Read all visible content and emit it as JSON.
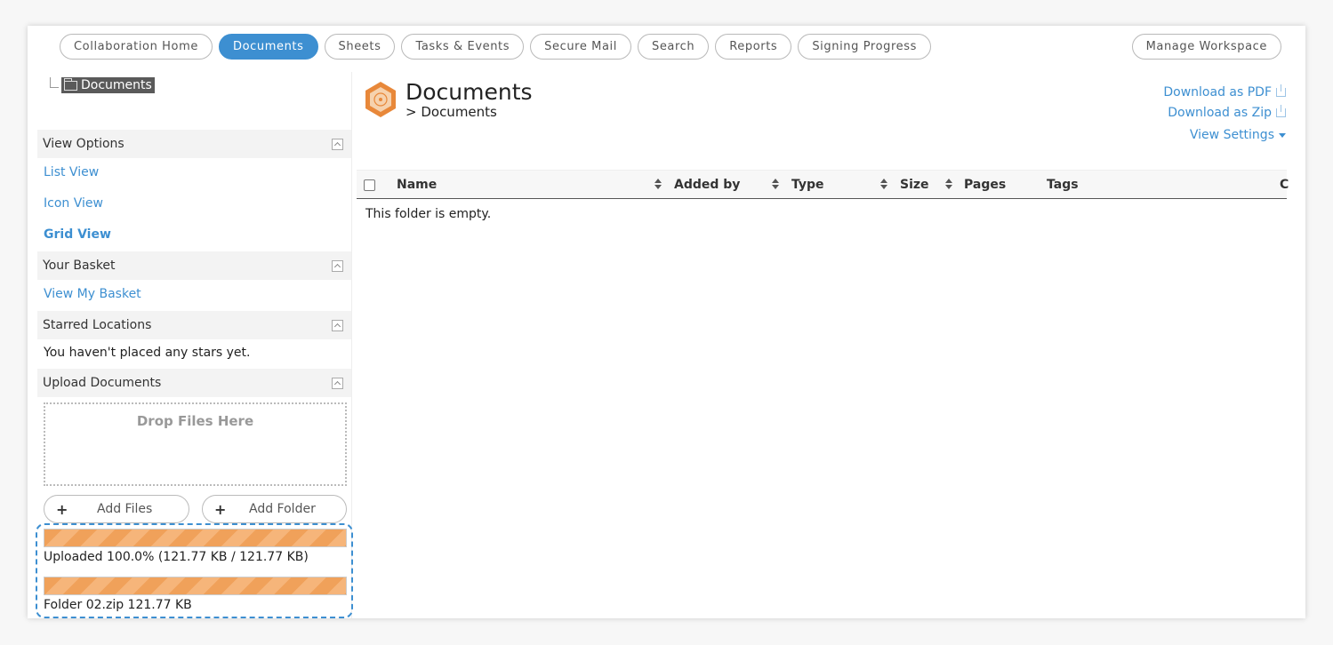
{
  "nav": {
    "tabs": [
      {
        "label": "Collaboration Home"
      },
      {
        "label": "Documents",
        "active": true
      },
      {
        "label": "Sheets"
      },
      {
        "label": "Tasks & Events"
      },
      {
        "label": "Secure Mail"
      },
      {
        "label": "Search"
      },
      {
        "label": "Reports"
      },
      {
        "label": "Signing Progress"
      }
    ],
    "manage": "Manage Workspace"
  },
  "tree": {
    "root": "Documents"
  },
  "sidebar": {
    "view_options": {
      "title": "View Options",
      "items": [
        "List View",
        "Icon View",
        "Grid View"
      ],
      "selected": "Grid View"
    },
    "basket": {
      "title": "Your Basket",
      "link": "View My Basket"
    },
    "starred": {
      "title": "Starred Locations",
      "empty": "You haven't placed any stars yet."
    },
    "upload": {
      "title": "Upload Documents",
      "drop": "Drop Files Here",
      "add_files": "Add Files",
      "add_folder": "Add Folder",
      "progress": [
        {
          "percent": 100,
          "text": "Uploaded 100.0% (121.77 KB / 121.77 KB)"
        },
        {
          "percent": 100,
          "text": "Folder 02.zip 121.77 KB"
        }
      ]
    }
  },
  "main": {
    "title": "Documents",
    "breadcrumb": "> Documents",
    "download_pdf": "Download as PDF",
    "download_zip": "Download as Zip",
    "view_settings": "View Settings",
    "columns": [
      "Name",
      "Added by",
      "Type",
      "Size",
      "Pages",
      "Tags",
      "C"
    ],
    "empty": "This folder is empty."
  },
  "colors": {
    "accent": "#3d8fd1",
    "progress": "#f0a15a",
    "logo": "#e8883a"
  }
}
